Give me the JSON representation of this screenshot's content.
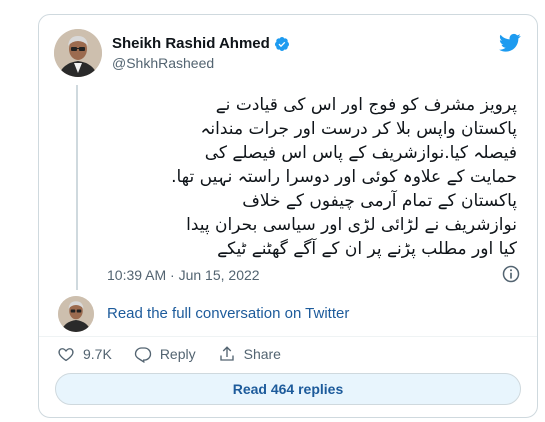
{
  "author": {
    "name": "Sheikh Rashid Ahmed",
    "handle": "@ShkhRasheed"
  },
  "tweet": {
    "lines": [
      "پرویز مشرف کو فوج اور اس کی قیادت نے",
      "پاکستان واپس بلا کر درست اور جرات مندانہ",
      "فیصلہ کیا.نوازشریف کے پاس اس فیصلے کی",
      "حمایت کے علاوہ کوئی اور دوسرا راستہ نہیں تھا.",
      "پاکستان کے تمام آرمی چیفوں کے خلاف",
      "نوازشریف نے لڑائی لڑی اور سیاسی بحران پیدا",
      "کیا اور مطلب پڑنے پر ان کے آگے گھٹنے ٹیکے"
    ],
    "timestamp": "10:39 AM · Jun 15, 2022"
  },
  "conversation_link": "Read the full conversation on Twitter",
  "actions": {
    "likes": "9.7K",
    "reply": "Reply",
    "share": "Share"
  },
  "read_replies": "Read 464 replies",
  "colors": {
    "accent": "#1d9bf0",
    "link": "#1d5b9b",
    "muted": "#536471",
    "border": "#cfd9de"
  }
}
